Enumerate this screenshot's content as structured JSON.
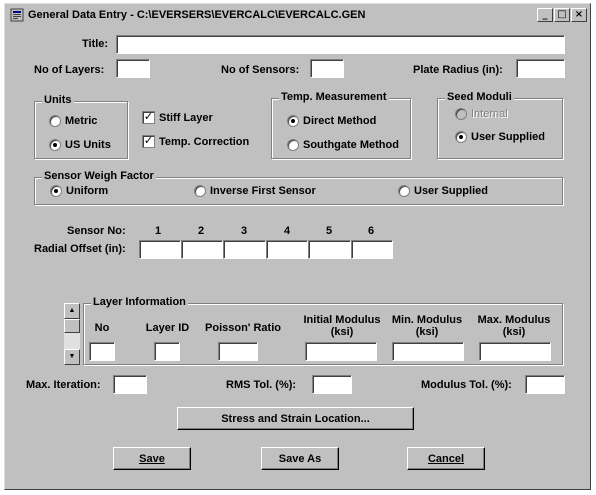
{
  "window": {
    "title": "General Data Entry - C:\\EVERSERS\\EVERCALC\\EVERCALC.GEN",
    "icon": "app-icon",
    "controls": {
      "minimize": "_",
      "maximize": "□",
      "close": "×"
    }
  },
  "header": {
    "title_label": "Title:",
    "title_value": "",
    "layers_label": "No of Layers:",
    "layers_value": "",
    "sensors_label": "No of Sensors:",
    "sensors_value": "",
    "plate_label": "Plate Radius (in):",
    "plate_value": ""
  },
  "units": {
    "title": "Units",
    "options": [
      "Metric",
      "US Units"
    ],
    "selected": "US Units"
  },
  "checkboxes": [
    {
      "label": "Stiff Layer",
      "checked": true
    },
    {
      "label": "Temp. Correction",
      "checked": true
    }
  ],
  "temp": {
    "title": "Temp. Measurement",
    "options": [
      "Direct Method",
      "Southgate Method"
    ],
    "selected": "Direct Method"
  },
  "seed": {
    "title": "Seed Moduli",
    "options": [
      "Internal",
      "User Supplied"
    ],
    "selected": "User Supplied",
    "disabled": [
      "Internal"
    ]
  },
  "weigh": {
    "title": "Sensor Weigh Factor",
    "options": [
      "Uniform",
      "Inverse First Sensor",
      "User Supplied"
    ],
    "selected": "Uniform"
  },
  "sensors": {
    "no_label": "Sensor No:",
    "offset_label": "Radial Offset (in):",
    "numbers": [
      "1",
      "2",
      "3",
      "4",
      "5",
      "6"
    ],
    "offsets": [
      "",
      "",
      "",
      "",
      "",
      ""
    ]
  },
  "layer": {
    "title": "Layer Information",
    "cols": [
      "No",
      "Layer ID",
      "Poisson' Ratio",
      "Initial Modulus\n(ksi)",
      "Min. Modulus\n(ksi)",
      "Max. Modulus\n(ksi)"
    ],
    "values": [
      "",
      "",
      "",
      "",
      "",
      ""
    ]
  },
  "tolerances": {
    "iter_label": "Max. Iteration:",
    "iter_value": "",
    "rms_label": "RMS Tol. (%):",
    "rms_value": "",
    "mod_label": "Modulus Tol. (%):",
    "mod_value": ""
  },
  "buttons": {
    "stress": "Stress and Strain Location...",
    "save": "Save",
    "save_as": "Save As",
    "cancel": "Cancel"
  },
  "colors": {
    "face": "#c0c0c0",
    "shadow": "#808080",
    "highlight": "#ffffff"
  }
}
